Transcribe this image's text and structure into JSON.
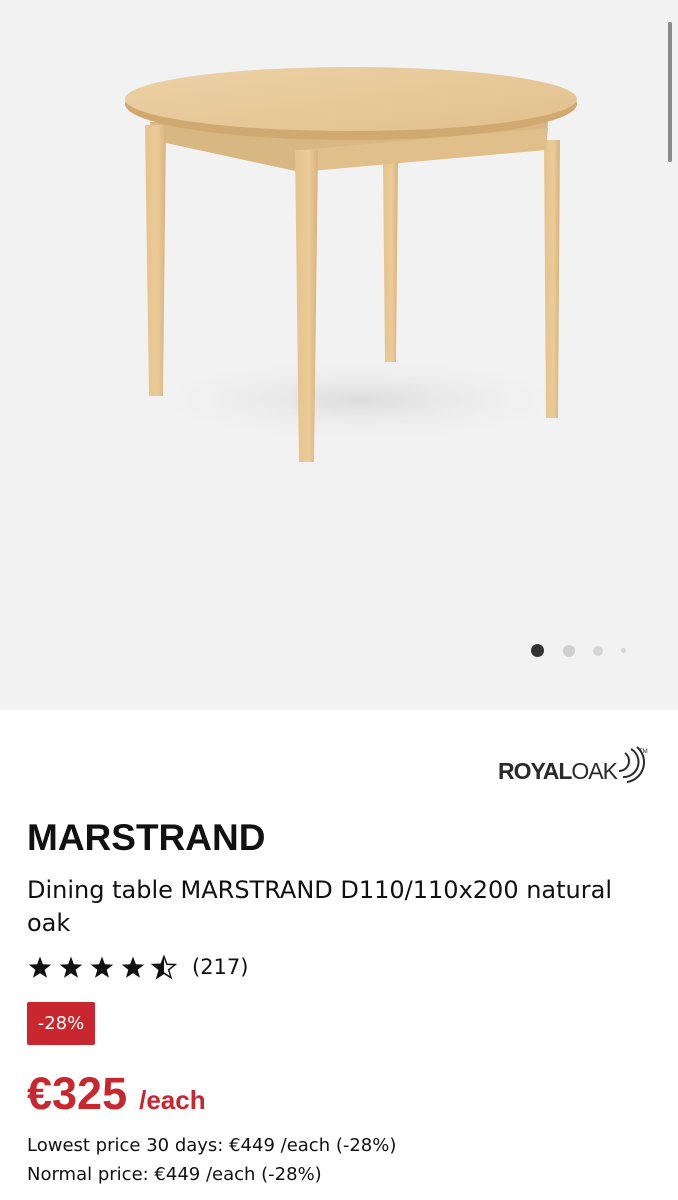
{
  "gallery": {
    "image_alt": "Dining table MARSTRAND natural oak",
    "active_slide": 1,
    "slide_count": 4
  },
  "brand": {
    "part1": "ROYAL",
    "part2": "OAK",
    "trademark": "TM"
  },
  "product": {
    "name": "MARSTRAND",
    "description": "Dining table MARSTRAND D110/110x200 natural oak",
    "rating": 4.5,
    "rating_max": 5,
    "review_count": "(217)",
    "discount_badge": "-28%",
    "price": "€325",
    "price_unit": "/each",
    "lowest_price_note": "Lowest price 30 days: €449 /each (-28%)",
    "normal_price_note": "Normal price: €449 /each (-28%)"
  },
  "colors": {
    "accent_red": "#c8272f",
    "wood": "#e3c08a"
  }
}
